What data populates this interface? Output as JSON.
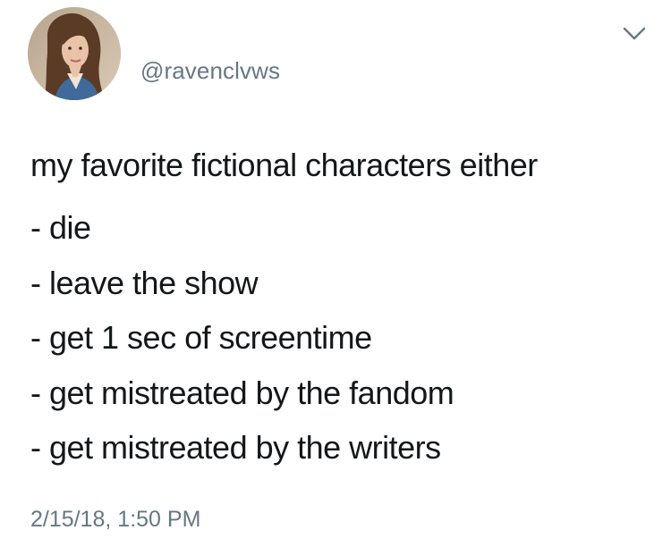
{
  "tweet": {
    "handle": "@ravenclvws",
    "intro": "my favorite fictional characters either",
    "list_items": [
      "- die",
      "- leave the show",
      "- get 1 sec of screentime",
      "- get mistreated by the fandom",
      "- get mistreated by the writers"
    ],
    "timestamp": "2/15/18, 1:50 PM"
  },
  "icons": {
    "avatar": "profile-photo",
    "menu": "chevron-down-icon"
  },
  "colors": {
    "text": "#14171a",
    "secondary": "#657786",
    "background": "#ffffff"
  }
}
